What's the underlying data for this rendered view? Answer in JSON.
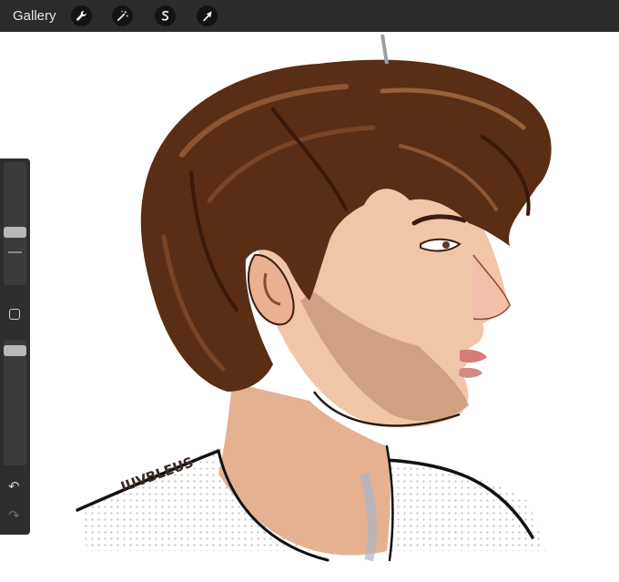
{
  "topbar": {
    "gallery_label": "Gallery",
    "tools": [
      {
        "name": "wrench-icon",
        "label": "Actions"
      },
      {
        "name": "magic-wand-icon",
        "label": "Adjustments"
      },
      {
        "name": "selection-s-icon",
        "label": "Selection"
      },
      {
        "name": "transform-arrow-icon",
        "label": "Transform"
      }
    ]
  },
  "artwork": {
    "signature": "IUVBLEUS",
    "subject": "portrait of a young man in profile with curly brown hair"
  },
  "sidebar": {
    "brush_size_level": 0.38,
    "opacity_level": 0.95,
    "undo_icon": "undo-icon",
    "redo_icon": "redo-icon"
  },
  "colors": {
    "toolbar": "#2b2b2b",
    "tool_button": "#131313",
    "hair": "#5a2e14",
    "skin": "#e8b896"
  }
}
